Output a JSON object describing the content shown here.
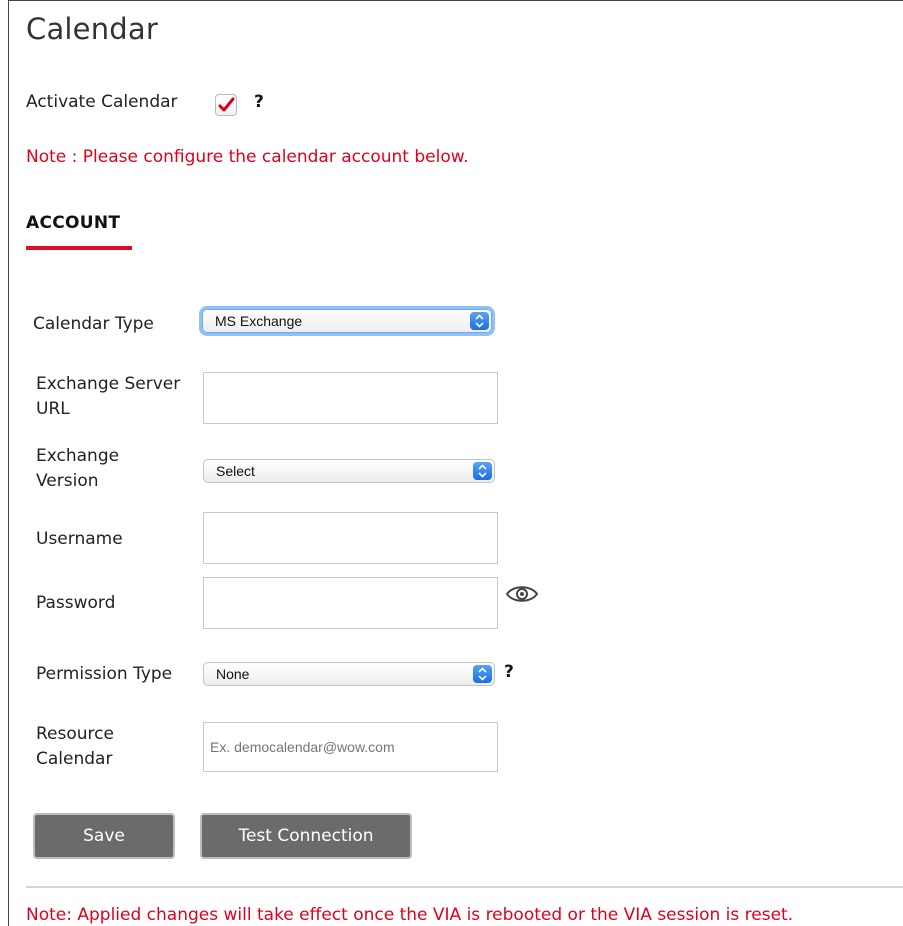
{
  "page": {
    "title": "Calendar",
    "activate_label": "Activate Calendar",
    "activate_checked": true,
    "help_symbol": "?",
    "note_top": "Note : Please configure the calendar account below.",
    "note_bottom": "Note: Applied changes will take effect once the VIA is rebooted or the VIA session is reset."
  },
  "section": {
    "title": "ACCOUNT",
    "accent_color": "#d8102a"
  },
  "form": {
    "calendar_type": {
      "label": "Calendar Type",
      "value": "MS Exchange"
    },
    "exchange_server_url": {
      "label_line1": "Exchange Server",
      "label_line2": "URL",
      "value": ""
    },
    "exchange_version": {
      "label_line1": "Exchange",
      "label_line2": "Version",
      "value": "Select"
    },
    "username": {
      "label": "Username",
      "value": ""
    },
    "password": {
      "label": "Password",
      "value": "",
      "toggle_icon": "eye-icon"
    },
    "permission_type": {
      "label": "Permission Type",
      "value": "None"
    },
    "resource_calendar": {
      "label_line1": "Resource",
      "label_line2": "Calendar",
      "placeholder": "Ex. democalendar@wow.com"
    }
  },
  "buttons": {
    "save_label": "Save",
    "test_connection_label": "Test Connection"
  },
  "colors": {
    "note_red": "#e0001b",
    "button_gray": "#6b6b6b",
    "select_blue": "#1a6fe0"
  }
}
